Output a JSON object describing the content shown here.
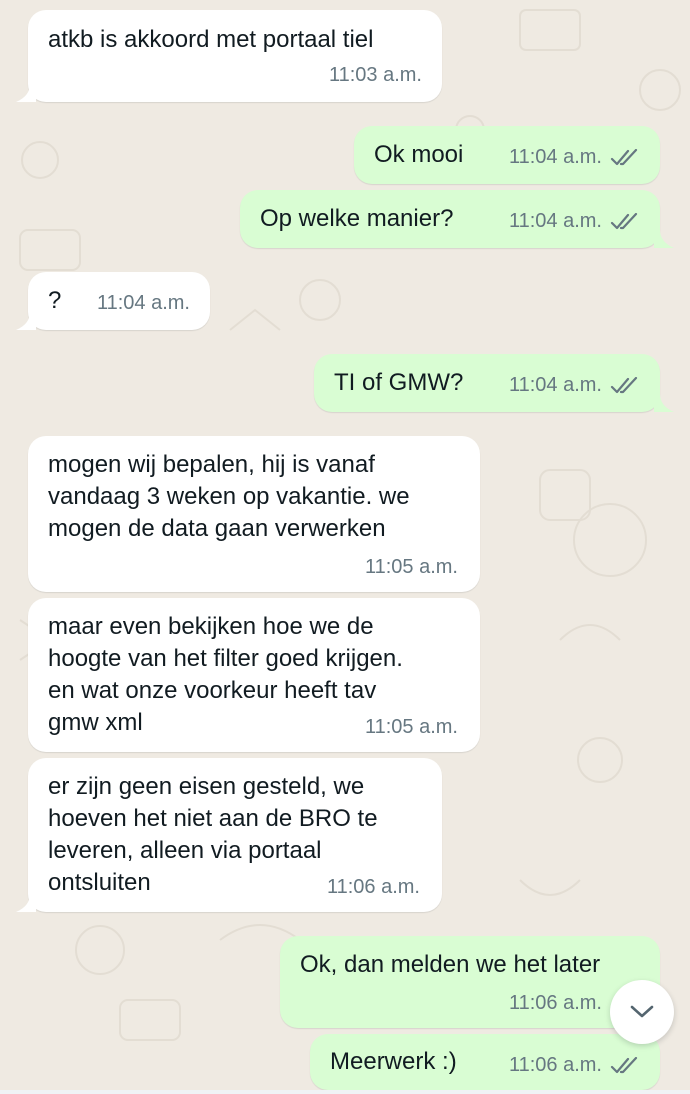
{
  "colors": {
    "chat_background": "#efeae2",
    "incoming_bubble": "#ffffff",
    "outgoing_bubble": "#d9fdd3",
    "meta_text": "#667781",
    "message_text": "#111b21"
  },
  "messages": [
    {
      "direction": "incoming",
      "text": "atkb is akkoord met portaal tiel",
      "time": "11:03 a.m."
    },
    {
      "direction": "outgoing",
      "text": "Ok mooi",
      "time": "11:04 a.m.",
      "status_icon": "double-check-icon"
    },
    {
      "direction": "outgoing",
      "text": "Op welke manier?",
      "time": "11:04 a.m.",
      "status_icon": "double-check-icon"
    },
    {
      "direction": "incoming",
      "text": "?",
      "time": "11:04 a.m."
    },
    {
      "direction": "outgoing",
      "text": "TI of GMW?",
      "time": "11:04 a.m.",
      "status_icon": "double-check-icon"
    },
    {
      "direction": "incoming",
      "lines": [
        "mogen wij bepalen, hij is vanaf",
        "vandaag 3 weken op vakantie. we",
        "mogen de data gaan verwerken"
      ],
      "time": "11:05 a.m."
    },
    {
      "direction": "incoming",
      "lines": [
        "maar even bekijken hoe we de",
        "hoogte van het filter goed krijgen.",
        "en wat onze voorkeur heeft tav",
        "gmw xml"
      ],
      "time": "11:05 a.m."
    },
    {
      "direction": "incoming",
      "lines": [
        "er zijn geen eisen gesteld, we",
        "hoeven het niet aan de BRO te",
        "leveren, alleen via portaal",
        "ontsluiten"
      ],
      "time": "11:06 a.m."
    },
    {
      "direction": "outgoing",
      "text": "Ok, dan melden we het later",
      "time": "11:06 a.m."
    },
    {
      "direction": "outgoing",
      "text": "Meerwerk :)",
      "time": "11:06 a.m.",
      "status_icon": "double-check-icon"
    }
  ],
  "scroll_button_icon": "chevron-down-icon"
}
